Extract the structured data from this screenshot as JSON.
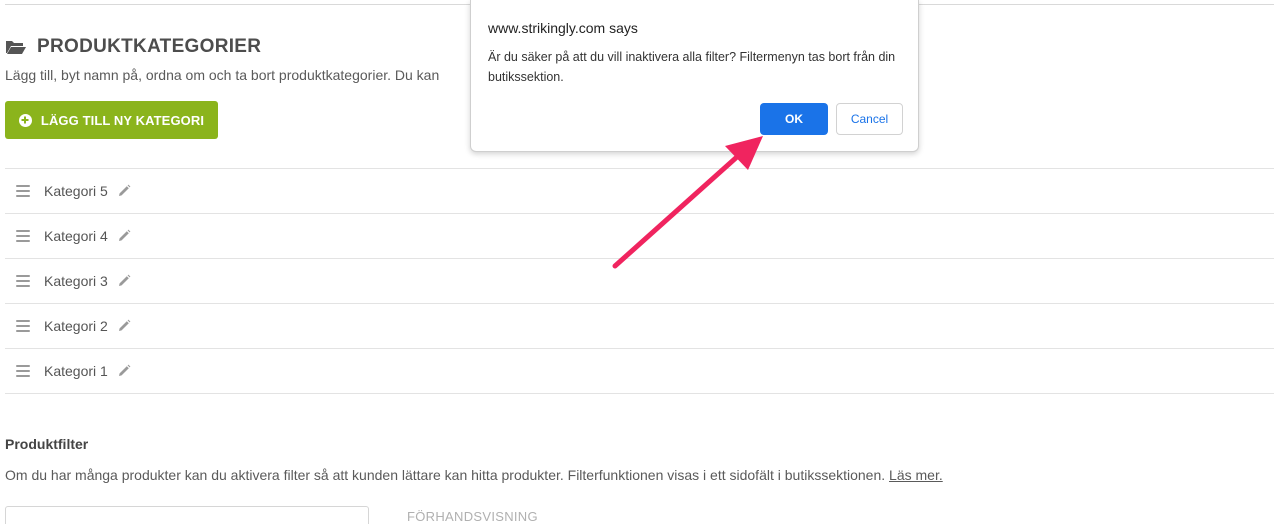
{
  "categories_section": {
    "title": "PRODUKTKATEGORIER",
    "description": "Lägg till, byt namn på, ordna om och ta bort produktkategorier. Du kan",
    "add_button_label": "LÄGG TILL NY KATEGORI",
    "items": [
      {
        "label": "Kategori 5"
      },
      {
        "label": "Kategori 4"
      },
      {
        "label": "Kategori 3"
      },
      {
        "label": "Kategori 2"
      },
      {
        "label": "Kategori 1"
      }
    ]
  },
  "filter_section": {
    "title": "Produktfilter",
    "description": "Om du har många produkter kan du aktivera filter så att kunden lättare kan hitta produkter. Filterfunktionen visas i ett sidofält i butikssektionen.",
    "read_more_link": "Läs mer.",
    "preview_label": "FÖRHANDSVISNING"
  },
  "dialog": {
    "origin": "www.strikingly.com says",
    "message": "Är du säker på att du vill inaktivera alla filter? Filtermenyn tas bort från din butikssektion.",
    "ok_label": "OK",
    "cancel_label": "Cancel"
  },
  "icons": {
    "folder": "folder-open-icon",
    "add": "plus-circle-icon",
    "drag": "drag-handle-icon",
    "edit": "pencil-icon",
    "annotation": "arrow-annotation"
  },
  "colors": {
    "primary_green": "#8bb41c",
    "dialog_blue": "#1a73e8",
    "annotation_pink": "#f0245f"
  }
}
